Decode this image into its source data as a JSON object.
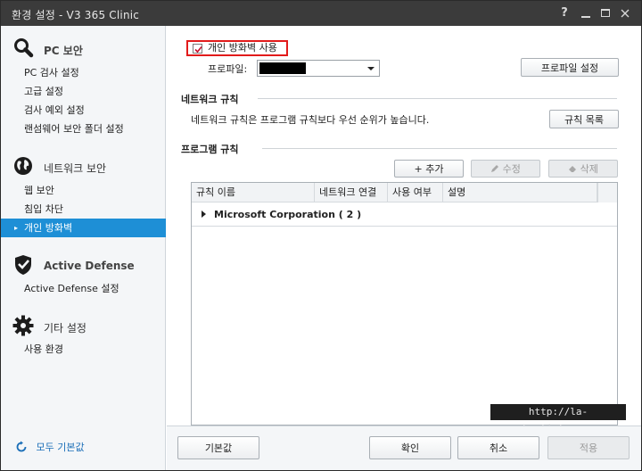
{
  "window": {
    "title": "환경 설정 - V3 365 Clinic",
    "help": "?"
  },
  "sidebar": {
    "sections": [
      {
        "icon": "magnifier-icon",
        "label": "PC 보안",
        "items": [
          "PC 검사 설정",
          "고급 설정",
          "검사 예외 설정",
          "랜섬웨어 보안 폴더 설정"
        ]
      },
      {
        "icon": "globe-icon",
        "label": "네트워크 보안",
        "items": [
          "웹 보안",
          "침입 차단",
          "개인 방화벽"
        ]
      },
      {
        "icon": "shield-check-icon",
        "label": "Active Defense",
        "items": [
          "Active Defense 설정"
        ]
      },
      {
        "icon": "gear-icon",
        "label": "기타 설정",
        "items": [
          "사용 환경"
        ]
      }
    ],
    "active_item": "개인 방화벽",
    "reset_all": "모두 기본값"
  },
  "firewall": {
    "enable_label": "개인 방화벽 사용",
    "enabled": true,
    "profile_label": "프로파일:",
    "profile_value": "",
    "profile_settings_button": "프로파일 설정"
  },
  "network_rules": {
    "title": "네트워크 규칙",
    "description": "네트워크 규칙은 프로그램 규칙보다 우선 순위가 높습니다.",
    "list_button": "규칙 목록"
  },
  "program_rules": {
    "title": "프로그램 규칙",
    "add_button": "+ 추가",
    "edit_button": "수정",
    "delete_button": "삭제",
    "columns": [
      "규칙 이름",
      "네트워크 연결",
      "사용 여부",
      "설명"
    ],
    "groups": [
      {
        "label": "Microsoft Corporation ( 2 )"
      }
    ]
  },
  "watermark": "http://la-nube.tistory.com",
  "footer": {
    "default_button": "기본값",
    "ok_button": "확인",
    "cancel_button": "취소",
    "apply_button": "적용"
  },
  "colors": {
    "titlebar": "#3b3b3b",
    "accent": "#1e8fd6",
    "highlight_box": "#e21b1b"
  }
}
